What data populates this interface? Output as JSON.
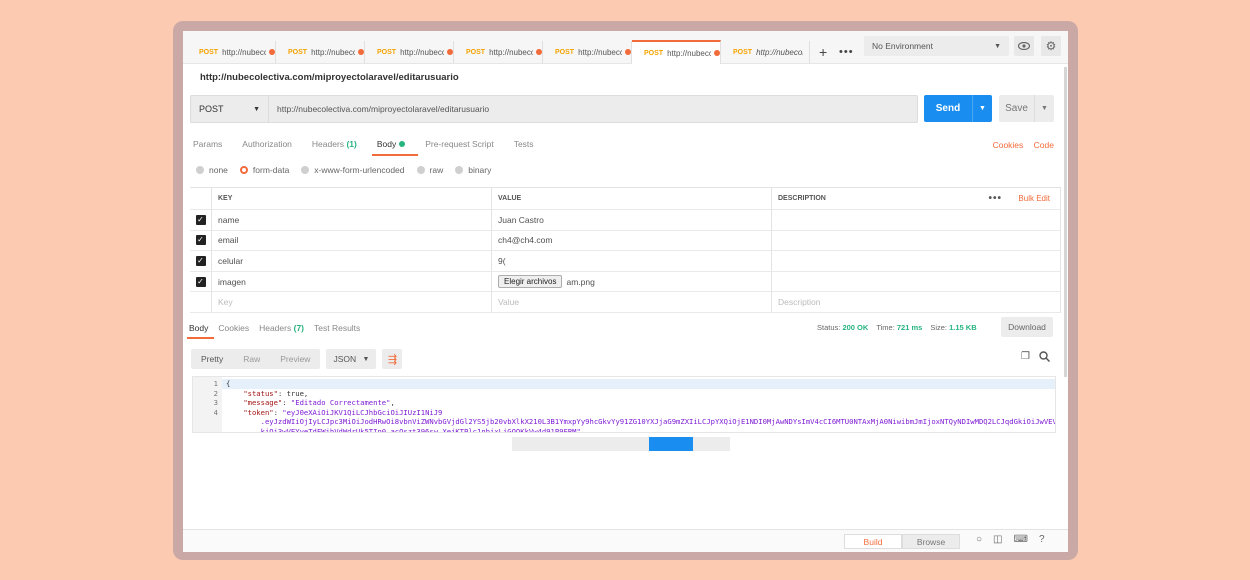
{
  "tabs": [
    {
      "method": "POST",
      "url": "http://nubecc",
      "active": false,
      "italic": false
    },
    {
      "method": "POST",
      "url": "http://nubecc",
      "active": false,
      "italic": false
    },
    {
      "method": "POST",
      "url": "http://nubecc",
      "active": false,
      "italic": false
    },
    {
      "method": "POST",
      "url": "http://nubecolec",
      "active": false,
      "italic": false
    },
    {
      "method": "POST",
      "url": "http://nubecc",
      "active": false,
      "italic": false
    },
    {
      "method": "POST",
      "url": "http://nubecc",
      "active": true,
      "italic": false
    },
    {
      "method": "POST",
      "url": "http://nubecolec",
      "active": false,
      "italic": true
    }
  ],
  "new_tab_icon": "plus-icon",
  "environment": {
    "selected": "No Environment"
  },
  "request": {
    "title": "http://nubecolectiva.com/miproyectolaravel/editarusuario",
    "method": "POST",
    "url": "http://nubecolectiva.com/miproyectolaravel/editarusuario",
    "send_label": "Send",
    "save_label": "Save"
  },
  "request_tabs": {
    "params": "Params",
    "authorization": "Authorization",
    "headers": "Headers",
    "headers_count": "(1)",
    "body": "Body",
    "prerequest": "Pre-request Script",
    "tests": "Tests",
    "cookies": "Cookies",
    "code": "Code"
  },
  "body_modes": {
    "none": "none",
    "form_data": "form-data",
    "urlencoded": "x-www-form-urlencoded",
    "raw": "raw",
    "binary": "binary",
    "selected": "form-data"
  },
  "kv_table": {
    "headers": {
      "key": "KEY",
      "value": "VALUE",
      "description": "DESCRIPTION",
      "bulk_edit": "Bulk Edit"
    },
    "rows": [
      {
        "checked": true,
        "key": "name",
        "value": "Juan Castro"
      },
      {
        "checked": true,
        "key": "email",
        "value": "ch4@ch4.com"
      },
      {
        "checked": true,
        "key": "celular",
        "value": "9("
      },
      {
        "checked": true,
        "key": "imagen",
        "file_button": "Elegir archivos",
        "value": "am.png"
      }
    ],
    "placeholder": {
      "key": "Key",
      "value": "Value",
      "description": "Description"
    }
  },
  "response_tabs": {
    "body": "Body",
    "cookies": "Cookies",
    "headers": "Headers",
    "headers_count": "(7)",
    "test_results": "Test Results"
  },
  "response_stats": {
    "status_label": "Status:",
    "status": "200 OK",
    "time_label": "Time:",
    "time": "721 ms",
    "size_label": "Size:",
    "size": "1.15 KB",
    "download": "Download"
  },
  "format_bar": {
    "pretty": "Pretty",
    "raw": "Raw",
    "preview": "Preview",
    "format": "JSON"
  },
  "response_code": [
    {
      "n": "1",
      "text": "{"
    },
    {
      "n": "2",
      "key": "\"status\"",
      "rest": ": true,"
    },
    {
      "n": "3",
      "key": "\"message\"",
      "sep": ": ",
      "str": "\"Editado Correctamente\"",
      "rest": ","
    },
    {
      "n": "4",
      "key": "\"token\"",
      "sep": ": ",
      "str": "\"eyJ0eXAiOiJKV1QiLCJhbGciOiJIUzI1NiJ9"
    },
    {
      "n": "",
      "str": ".eyJzdWIiOjIyLCJpc3MiOiJodHRwOi8vbnViZWNvbGVjdGl2YS5jb20vbXlkX210L3B1YmxpYy9hcGkvYy91ZG10YXJjaG9mZXIiLCJpYXQiOjE1NDI0MjAwNDYsImV4cCI6MTU0NTAxMjA0NiwibmJmIjoxNTQyNDIwMDQ2LCJqdGkiOiJwVEVyeTdFWjhVdWdrUk5TIn0.aC0szt396sw_Xe"
    },
    {
      "n": "",
      "str": "kiOi3wVEYyeTdFWjhVdWdrUk5TIn0.acOszt396sw_XejKTPlc1nbixLiGOOKkVw4d91P9ERM\"",
      "rest": ","
    }
  ],
  "status_bar": {
    "build": "Build",
    "browse": "Browse"
  }
}
